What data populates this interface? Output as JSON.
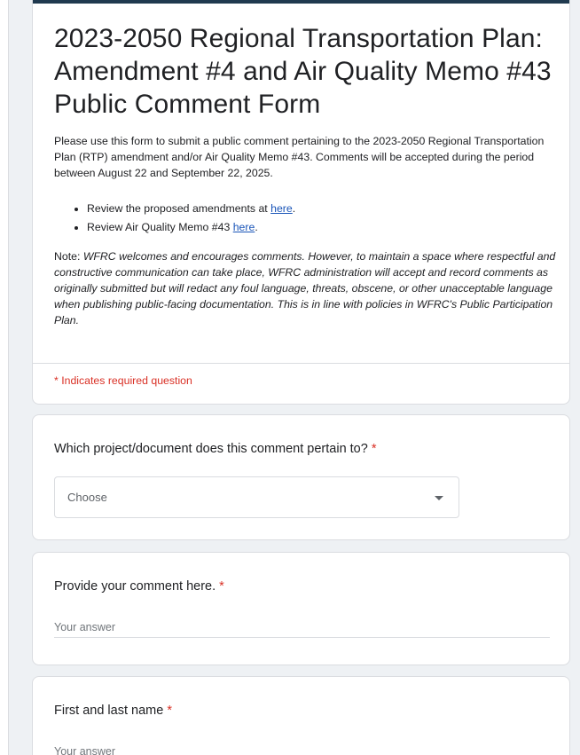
{
  "header": {
    "accent_color": "#203a4f",
    "title": "2023-2050 Regional Transportation Plan: Amendment #4 and Air Quality Memo #43 Public Comment Form",
    "description": "Please use this form to submit a public comment pertaining to the 2023-2050 Regional Transportation Plan (RTP) amendment and/or Air Quality Memo #43. Comments will be accepted during the period between August 22 and September 22, 2025.",
    "links": [
      {
        "text": "Review the proposed amendments at ",
        "link_text": "here",
        "suffix": "."
      },
      {
        "text": "Review Air Quality Memo #43 ",
        "link_text": "here",
        "suffix": "."
      }
    ],
    "note_label": "Note: ",
    "note_body": "WFRC welcomes and encourages comments. However, to maintain a space where respectful and constructive communication can take place, WFRC administration will accept and record comments as originally submitted but will redact any foul language, threats, obscene, or other unacceptable language when publishing public-facing documentation. This is in line with policies in WFRC's Public Participation Plan.",
    "required_note": "* Indicates required question"
  },
  "questions": [
    {
      "title": "Which project/document does this comment pertain to?",
      "required_mark": "*",
      "type": "dropdown",
      "selected": "Choose"
    },
    {
      "title": "Provide your comment here.",
      "required_mark": "*",
      "type": "text",
      "placeholder": "Your answer"
    },
    {
      "title": "First and last name",
      "required_mark": "*",
      "type": "text",
      "placeholder": "Your answer"
    }
  ],
  "colors": {
    "required": "#d93025",
    "link": "#1a55b8",
    "background": "#eef1f4"
  },
  "icons": {
    "dropdown": "caret-down-icon"
  }
}
